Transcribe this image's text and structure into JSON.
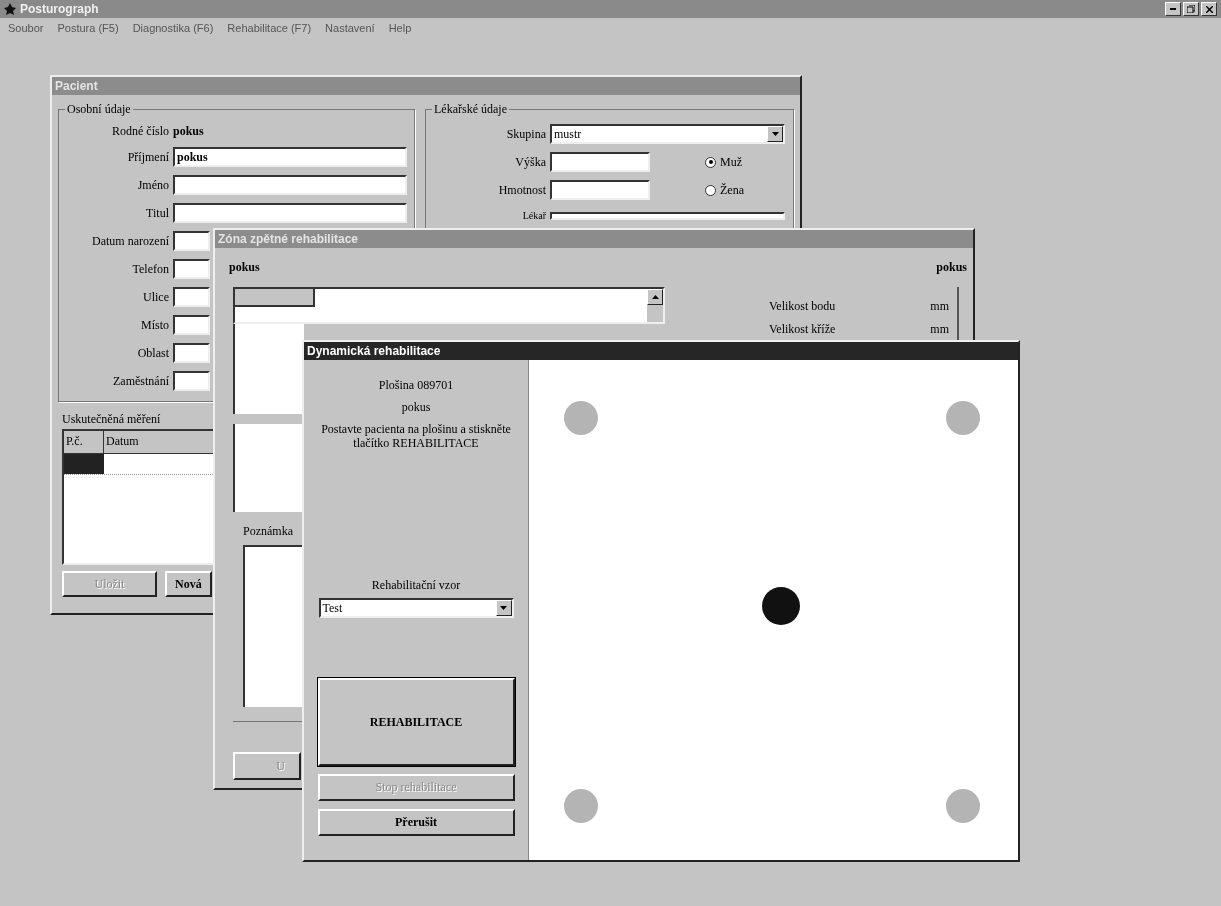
{
  "app": {
    "title": "Posturograph"
  },
  "menu": [
    "Soubor",
    "Postura (F5)",
    "Diagnostika (F6)",
    "Rehabilitace (F7)",
    "Nastavení",
    "Help"
  ],
  "patient_window": {
    "title": "Pacient",
    "personal": {
      "legend": "Osobní údaje",
      "birth_number_label": "Rodné číslo",
      "birth_number": "pokus",
      "fields": [
        {
          "label": "Příjmení",
          "value": "pokus"
        },
        {
          "label": "Jméno"
        },
        {
          "label": "Titul"
        },
        {
          "label": "Datum narození"
        },
        {
          "label": "Telefon"
        },
        {
          "label": "Ulice"
        },
        {
          "label": "Místo"
        },
        {
          "label": "Oblast"
        },
        {
          "label": "Zaměstnání"
        }
      ]
    },
    "medical": {
      "legend": "Lékařské údaje",
      "group_label": "Skupina",
      "group_value": "mustr",
      "fields": [
        {
          "label": "Výška"
        },
        {
          "label": "Hmotnost"
        }
      ],
      "sex": [
        {
          "label": "Muž",
          "selected": true
        },
        {
          "label": "Žena",
          "selected": false
        }
      ],
      "doctor_label": "Lékař"
    },
    "measurements": {
      "legend": "Uskutečněná měření",
      "columns": [
        "P.č.",
        "Datum"
      ],
      "rows": [
        {
          "selected": true
        }
      ]
    },
    "buttons": [
      {
        "label": "Uložit",
        "disabled": true
      },
      {
        "label": "Nová",
        "disabled": false
      }
    ]
  },
  "zone_window": {
    "title": "Zóna zpětné rehabilitace",
    "name_left": "pokus",
    "name_right": "pokus",
    "settings": [
      {
        "label": "Velikost bodu",
        "unit": "mm"
      },
      {
        "label": "Velikost kříže",
        "unit": "mm"
      }
    ],
    "note_label": "Poznámka",
    "button": {
      "label": "U",
      "disabled": true
    }
  },
  "rehab_window": {
    "title": "Dynamická rehabilitace",
    "platform": "Plošina 089701",
    "patient": "pokus",
    "instruction": "Postavte pacienta na plošinu a stiskněte tlačítko REHABILITACE",
    "pattern_label": "Rehabilitační vzor",
    "pattern_value": "Test",
    "buttons": [
      {
        "label": "REHABILITACE",
        "kind": "large",
        "disabled": false
      },
      {
        "label": "Stop rehabilitace",
        "kind": "normal",
        "disabled": true
      },
      {
        "label": "Přerušit",
        "kind": "normal",
        "disabled": false
      }
    ]
  }
}
